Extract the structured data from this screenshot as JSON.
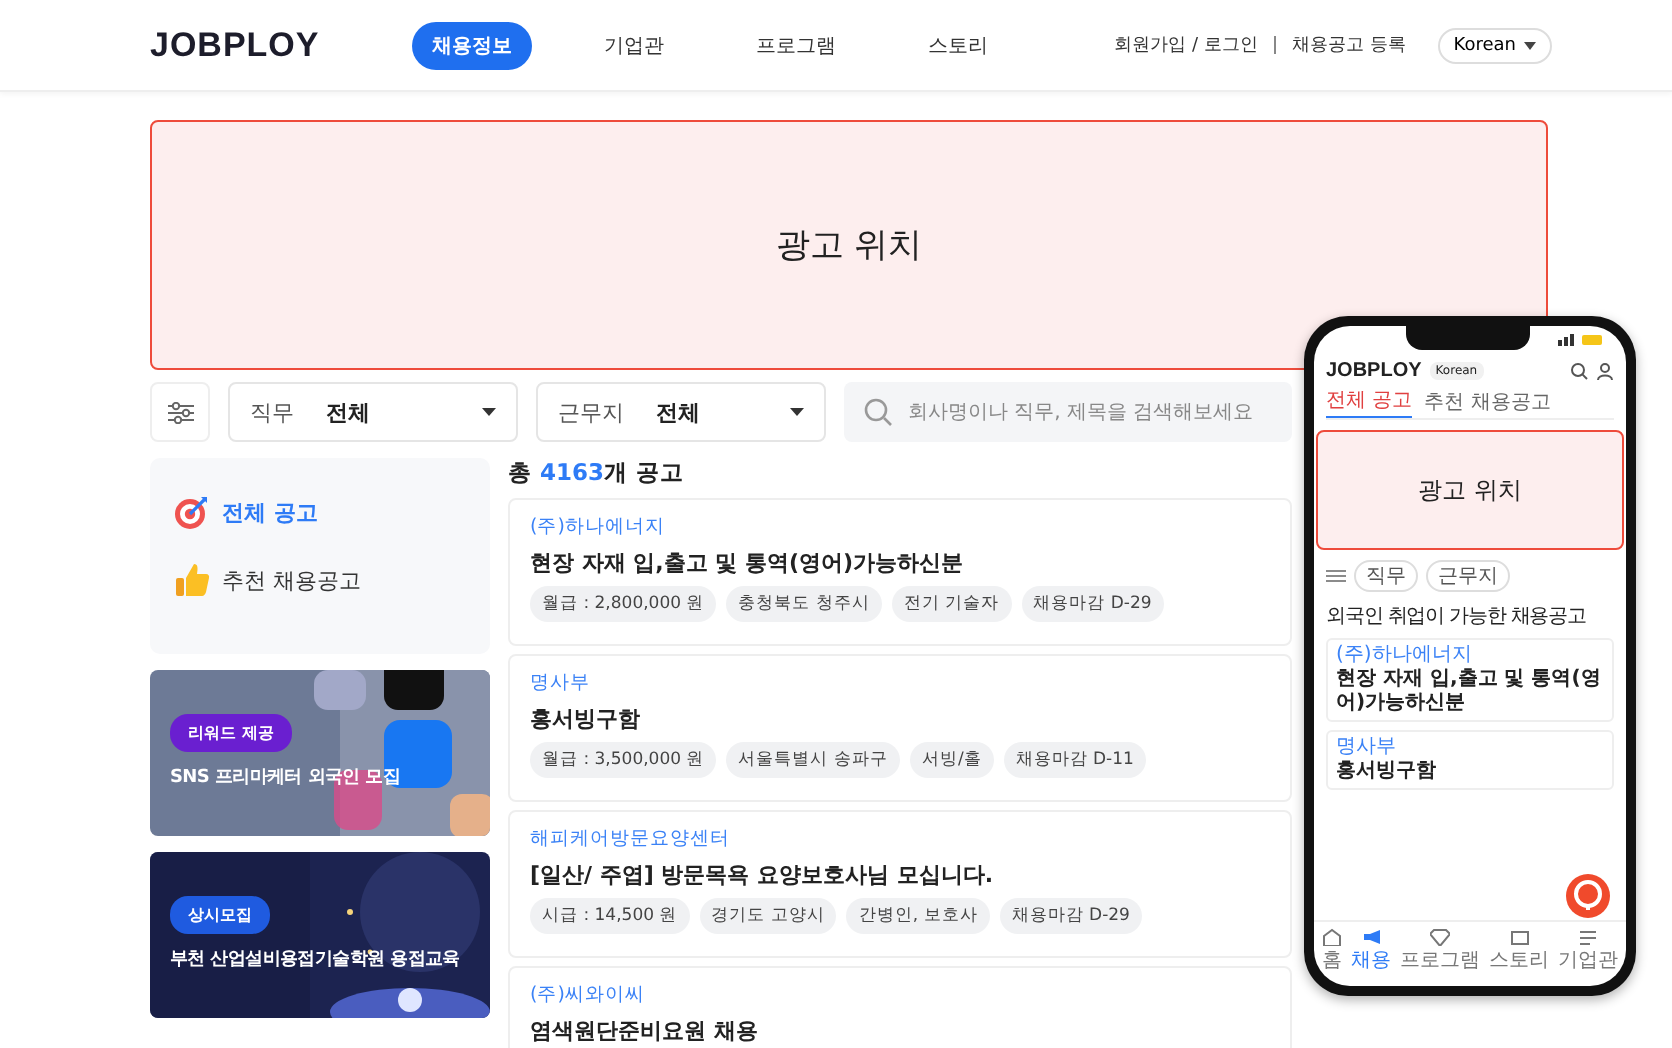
{
  "header": {
    "logo": "JOBPLOY",
    "nav": [
      {
        "label": "채용정보",
        "selected": true
      },
      {
        "label": "기업관",
        "selected": false
      },
      {
        "label": "프로그램",
        "selected": false
      },
      {
        "label": "스토리",
        "selected": false
      }
    ],
    "links": [
      "회원가입 / 로그인",
      "채용공고 등록"
    ],
    "language": "Korean"
  },
  "ad": {
    "label": "광고 위치"
  },
  "filters": [
    {
      "label": "직무",
      "value": "전체"
    },
    {
      "label": "근무지",
      "value": "전체"
    }
  ],
  "search": {
    "placeholder": "회사명이나 직무, 제목을 검색해보세요"
  },
  "sidebar": {
    "menu": [
      {
        "label": "전체 공고",
        "selected": true,
        "kind": "target"
      },
      {
        "label": "추천 채용공고",
        "selected": false,
        "kind": "thumb"
      }
    ],
    "banners": [
      {
        "badge": "리워드 제공",
        "title": "SNS 프리마케터 외국인 모집",
        "kind": "social"
      },
      {
        "badge": "상시모집",
        "title": "부천 산업설비용접기술학원 용접교육",
        "kind": "welding"
      }
    ]
  },
  "total": {
    "prefix": "총",
    "count": "4163",
    "suffix": "개 공고"
  },
  "jobs": [
    {
      "company": "(주)하나에너지",
      "title": "현장 자재 입,출고 및 통역(영어)가능하신분",
      "tags": [
        "월급 : 2,800,000 원",
        "충청북도 청주시",
        "전기 기술자",
        "채용마감 D-29"
      ]
    },
    {
      "company": "명사부",
      "title": "홍서빙구함",
      "tags": [
        "월급 : 3,500,000 원",
        "서울특별시 송파구",
        "서빙/홀",
        "채용마감 D-11"
      ]
    },
    {
      "company": "해피케어방문요양센터",
      "title": "[일산/ 주엽] 방문목욕 요양보호사님 모십니다.",
      "tags": [
        "시급 : 14,500 원",
        "경기도 고양시",
        "간병인, 보호사",
        "채용마감 D-29"
      ]
    },
    {
      "company": "(주)씨와이씨",
      "title": "염색원단준비요원 채용"
    }
  ],
  "phone": {
    "logo": "JOBPLOY",
    "language": "Korean",
    "tabs": [
      {
        "label": "전체 공고",
        "selected": true
      },
      {
        "label": "추천 채용공고",
        "selected": false
      }
    ],
    "ad": "광고 위치",
    "filters": [
      "직무",
      "근무지"
    ],
    "heading": "외국인 취업이 가능한 채용공고",
    "jobs": [
      {
        "company": "(주)하나에너지",
        "title": "현장 자재 입,출고 및 통역(영어)가능하신분"
      },
      {
        "company": "명사부",
        "title": "홍서빙구함"
      }
    ],
    "nav": [
      {
        "label": "홈",
        "selected": false,
        "kind": "home"
      },
      {
        "label": "채용",
        "selected": true,
        "kind": "megaphone"
      },
      {
        "label": "프로그램",
        "selected": false,
        "kind": "diamond"
      },
      {
        "label": "스토리",
        "selected": false,
        "kind": "story"
      },
      {
        "label": "기업관",
        "selected": false,
        "kind": "company"
      }
    ]
  }
}
